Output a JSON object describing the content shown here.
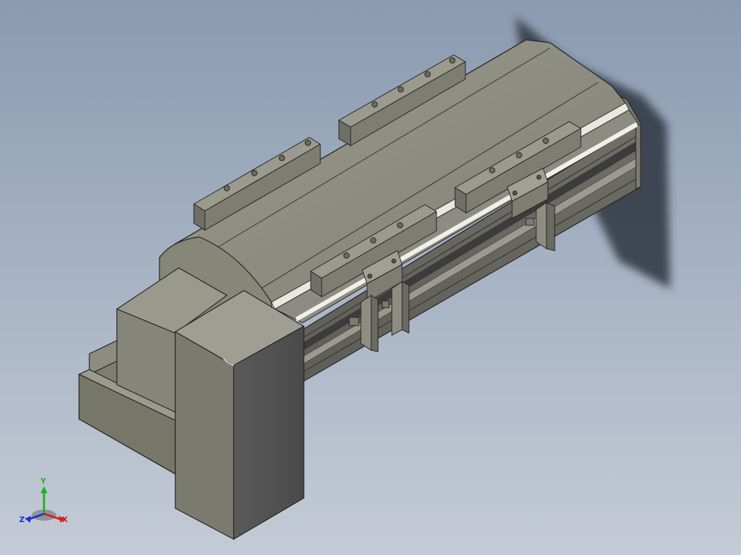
{
  "viewport": {
    "view": "isometric",
    "background_top": "#8a9ab0",
    "background_bottom": "#c4cbd6"
  },
  "model": {
    "description_icon": "linear-actuator-3d-model",
    "body_color": "#8b8b7f",
    "shadow_color": "#3a3f48"
  },
  "triad": {
    "x_label": "X",
    "y_label": "Y",
    "z_label": "Z",
    "x_color": "#d02020",
    "y_color": "#20b020",
    "z_color": "#2030d0"
  }
}
